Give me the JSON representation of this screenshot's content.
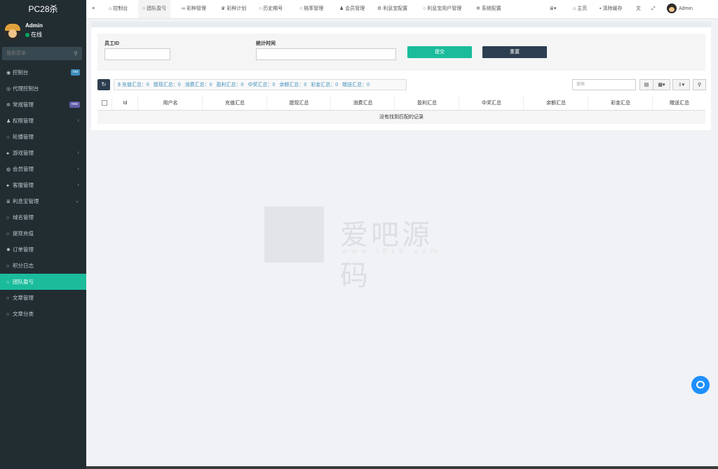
{
  "app": {
    "title": "PC28杀"
  },
  "user": {
    "name": "Admin",
    "status": "在线"
  },
  "sidebar": {
    "search_placeholder": "搜索菜单",
    "items": [
      {
        "label": "控制台",
        "icon": "dashboard-icon",
        "badge": "hot"
      },
      {
        "label": "代理控制台",
        "icon": "circle-icon"
      },
      {
        "label": "常规管理",
        "icon": "cogs-icon",
        "badge": "new"
      },
      {
        "label": "权限管理",
        "icon": "group-icon",
        "chevron": "‹"
      },
      {
        "label": "轮播管理",
        "icon": "circle-icon"
      },
      {
        "label": "游戏管理",
        "icon": "bomb-icon",
        "chevron": "‹"
      },
      {
        "label": "会员管理",
        "icon": "user-circle-icon",
        "chevron": "‹"
      },
      {
        "label": "客服管理",
        "icon": "chat-icon",
        "chevron": "‹"
      },
      {
        "label": "利息宝管理",
        "icon": "list-icon",
        "chevron": "⌄"
      },
      {
        "label": "域名管理",
        "icon": "circle-icon"
      },
      {
        "label": "提现充值",
        "icon": "circle-icon"
      },
      {
        "label": "订单管理",
        "icon": "gear-icon"
      },
      {
        "label": "积分日志",
        "icon": "circle-icon"
      },
      {
        "label": "团队盈亏",
        "icon": "circle-icon",
        "active": true
      },
      {
        "label": "文章管理",
        "icon": "circle-icon"
      },
      {
        "label": "文章分类",
        "icon": "circle-icon"
      }
    ]
  },
  "topbar": {
    "menu_toggle": "≡",
    "tabs": [
      {
        "label": "控制台",
        "icon": "⌂"
      },
      {
        "label": "团队盈亏",
        "icon": "○"
      },
      {
        "label": "彩种管理",
        "icon": "∞"
      },
      {
        "label": "彩种计划",
        "icon": "♛"
      },
      {
        "label": "历史期号",
        "icon": "○"
      },
      {
        "label": "赔率管理",
        "icon": "○"
      },
      {
        "label": "会员管理",
        "icon": "♟"
      },
      {
        "label": "利息宝配置",
        "icon": "⚙"
      },
      {
        "label": "利息宝用户管理",
        "icon": "○"
      },
      {
        "label": "系统配置",
        "icon": "✲"
      }
    ],
    "right": {
      "more_icon": "≣▾",
      "home": "主页",
      "clear_cache": "清除缓存",
      "translate_icon": "文",
      "fullscreen_icon": "⤢",
      "user": "Admin"
    }
  },
  "form": {
    "employee_id_label": "员工ID",
    "employee_id_value": "",
    "stat_time_label": "统计时间",
    "stat_time_value": "",
    "submit_label": "提交",
    "reset_label": "重置"
  },
  "summary": {
    "items": [
      "$ 充值汇总：0",
      "提现汇总：0",
      "消费汇总：0",
      "盈利汇总：0",
      "中奖汇总：0",
      "余额汇总：0",
      "彩金汇总：0",
      "赠送汇总：0"
    ]
  },
  "table": {
    "search_placeholder": "搜索",
    "columns": [
      "Id",
      "用户名",
      "充值汇总",
      "提现汇总",
      "消费汇总",
      "盈利汇总",
      "中奖汇总",
      "余额汇总",
      "彩金汇总",
      "赠送汇总"
    ],
    "empty_text": "没有找到匹配的记录"
  },
  "watermark": {
    "text": "爱吧源码",
    "sub": "www.i8zb.com"
  }
}
